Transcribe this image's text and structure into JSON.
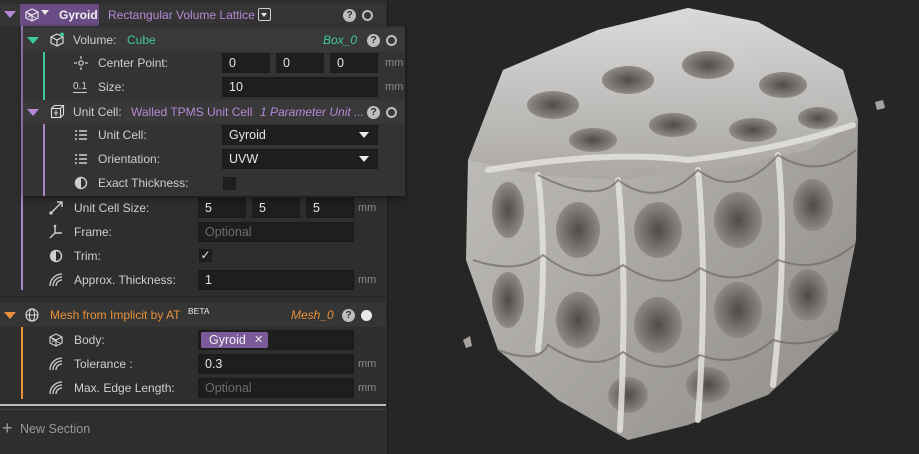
{
  "lattice": {
    "name": "Gyroid",
    "type": "Rectangular Volume Lattice",
    "volume": {
      "label": "Volume:",
      "value": "Cube",
      "ref": "Box_0",
      "center_point": {
        "label": "Center Point:",
        "x": "0",
        "y": "0",
        "z": "0",
        "unit": "mm"
      },
      "size": {
        "label": "Size:",
        "icon_text": "0.1",
        "value": "10",
        "unit": "mm"
      }
    },
    "unit_cell": {
      "label": "Unit Cell:",
      "value": "Walled TPMS Unit Cell",
      "ref": "1 Parameter Unit ...",
      "cell": {
        "label": "Unit Cell:",
        "value": "Gyroid"
      },
      "orientation": {
        "label": "Orientation:",
        "value": "UVW"
      },
      "exact_thickness": {
        "label": "Exact Thickness:",
        "checked": false
      }
    },
    "unit_cell_size": {
      "label": "Unit Cell Size:",
      "x": "5",
      "y": "5",
      "z": "5",
      "unit": "mm"
    },
    "frame": {
      "label": "Frame:",
      "placeholder": "Optional"
    },
    "trim": {
      "label": "Trim:",
      "checked": true,
      "check_glyph": "✓"
    },
    "approx_thickness": {
      "label": "Approx. Thickness:",
      "value": "1",
      "unit": "mm"
    }
  },
  "mesh": {
    "title": "Mesh from Implicit by AT",
    "badge": "BETA",
    "ref": "Mesh_0",
    "body": {
      "label": "Body:",
      "value": "Gyroid",
      "remove_glyph": "✕"
    },
    "tolerance": {
      "label": "Tolerance :",
      "value": "0.3",
      "unit": "mm"
    },
    "max_edge": {
      "label": "Max. Edge Length:",
      "placeholder": "Optional",
      "unit": "mm"
    }
  },
  "new_section": {
    "icon": "+",
    "label": "New Section"
  },
  "help_glyph": "?",
  "colors": {
    "lattice_accent": "#a884c8",
    "volume_accent": "#3fc79a",
    "mesh_accent": "#e8913a",
    "viewport_bg": "#262626"
  }
}
